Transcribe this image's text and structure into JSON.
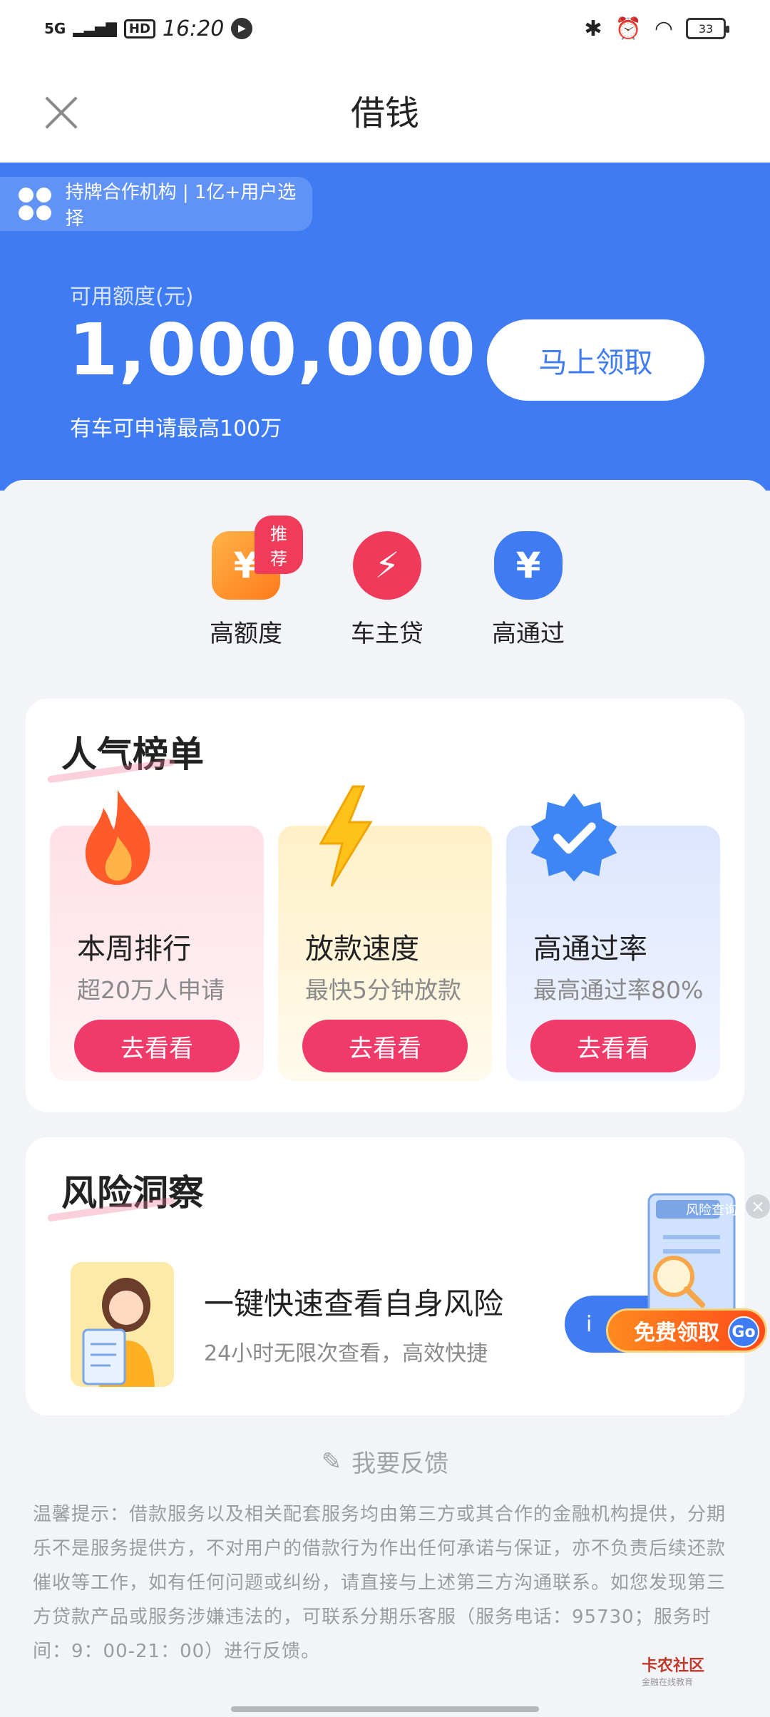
{
  "status_bar": {
    "network": "5G",
    "hd": "HD",
    "time": "16:20",
    "battery": "33"
  },
  "nav": {
    "title": "借钱"
  },
  "hero": {
    "partner_text": "持牌合作机构 | 1亿+用户选择",
    "credit_label": "可用额度(元)",
    "credit_amount": "1,000,000",
    "credit_note": "有车可申请最高100万",
    "claim_button": "马上领取"
  },
  "categories": [
    {
      "label": "高额度",
      "icon": "yuan-wallet-icon",
      "tag": "推荐"
    },
    {
      "label": "车主贷",
      "icon": "lightning-icon"
    },
    {
      "label": "高通过",
      "icon": "money-bag-icon"
    }
  ],
  "ranking": {
    "title": "人气榜单",
    "items": [
      {
        "title": "本周排行",
        "subtitle": "超20万人申请",
        "button": "去看看",
        "icon": "flame-icon"
      },
      {
        "title": "放款速度",
        "subtitle": "最快5分钟放款",
        "button": "去看看",
        "icon": "lightning-bolt-icon"
      },
      {
        "title": "高通过率",
        "subtitle": "最高通过率80%",
        "button": "去看看",
        "icon": "verified-badge-icon"
      }
    ]
  },
  "risk": {
    "title": "风险洞察",
    "headline": "一键快速查看自身风险",
    "subtitle": "24小时无限次查看，高效快捷",
    "go_button": "i"
  },
  "float_ad": {
    "label": "免费领取",
    "go": "Go",
    "doc_label": "风险查询"
  },
  "feedback": {
    "label": "我要反馈"
  },
  "disclaimer": "温馨提示：借款服务以及相关配套服务均由第三方或其合作的金融机构提供，分期乐不是服务提供方，不对用户的借款行为作出任何承诺与保证，亦不负责后续还款催收等工作，如有任何问题或纠纷，请直接与上述第三方沟通联系。如您发现第三方贷款产品或服务涉嫌违法的，可联系分期乐客服（服务电话：95730；服务时间：9：00-21：00）进行反馈。",
  "watermark": {
    "text": "卡农社区",
    "sub": "金融在线教育"
  },
  "colors": {
    "primary": "#3f7bf3",
    "accent": "#f03a6a",
    "orange": "#ff6a1a"
  }
}
